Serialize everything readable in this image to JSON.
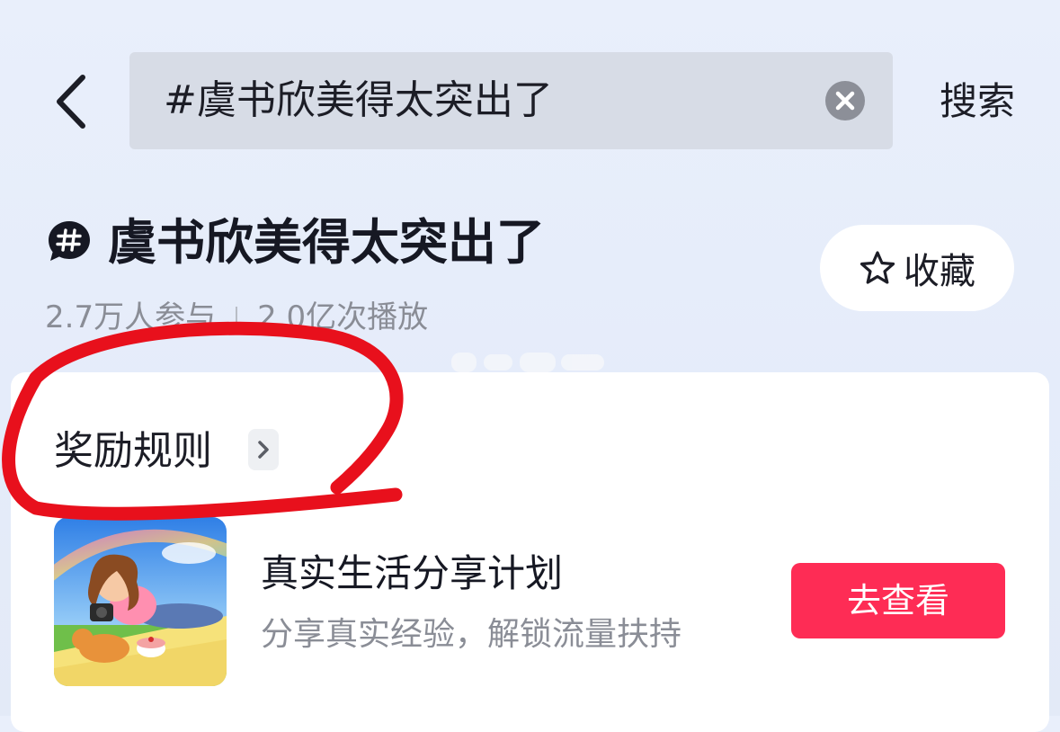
{
  "header": {
    "search_query": "#虞书欣美得太突出了",
    "search_button_label": "搜索"
  },
  "topic": {
    "title": "虞书欣美得太突出了",
    "favorite_label": "收藏",
    "participants": "2.7万人参与",
    "plays": "2.0亿次播放"
  },
  "reward_card": {
    "rules_label": "奖励规则",
    "plan_title": "真实生活分享计划",
    "plan_subtitle": "分享真实经验，解锁流量扶持",
    "view_button_label": "去查看"
  },
  "colors": {
    "primary_button": "#fe2c55",
    "annotation_stroke": "#e8101c",
    "search_box": "#d7dce6"
  },
  "icons": [
    "chevron-left-icon",
    "clear-icon",
    "hashtag-icon",
    "star-outline-icon",
    "chevron-right-icon"
  ]
}
